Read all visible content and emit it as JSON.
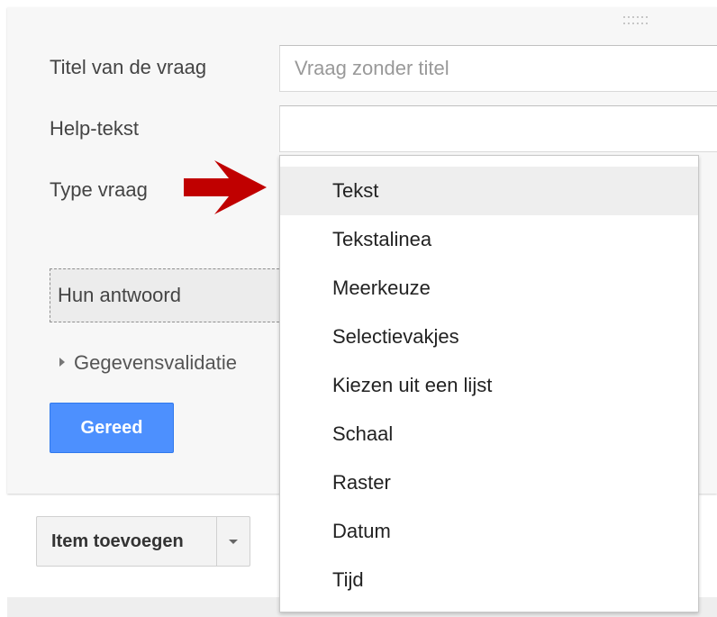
{
  "form": {
    "title_label": "Titel van de vraag",
    "title_placeholder": "Vraag zonder titel",
    "help_label": "Help-tekst",
    "help_value": "",
    "type_label": "Type vraag",
    "answer_preview": "Hun antwoord",
    "validation_label": "Gegevensvalidatie",
    "done_label": "Gereed"
  },
  "toolbar": {
    "add_item_label": "Item toevoegen"
  },
  "dropdown": {
    "selected_index": 0,
    "items": [
      {
        "label": "Tekst"
      },
      {
        "label": "Tekstalinea"
      },
      {
        "label": "Meerkeuze"
      },
      {
        "label": "Selectievakjes"
      },
      {
        "label": "Kiezen uit een lijst"
      },
      {
        "label": "Schaal"
      },
      {
        "label": "Raster"
      },
      {
        "label": "Datum"
      },
      {
        "label": "Tijd"
      }
    ]
  },
  "colors": {
    "accent_blue": "#4d90fe",
    "annotation_arrow": "#c00000",
    "selected_item_bg": "#eeeeee"
  },
  "icons": [
    "drag-handle-icon",
    "expand-triangle-icon",
    "dropdown-caret-icon",
    "annotation-arrow-icon"
  ]
}
